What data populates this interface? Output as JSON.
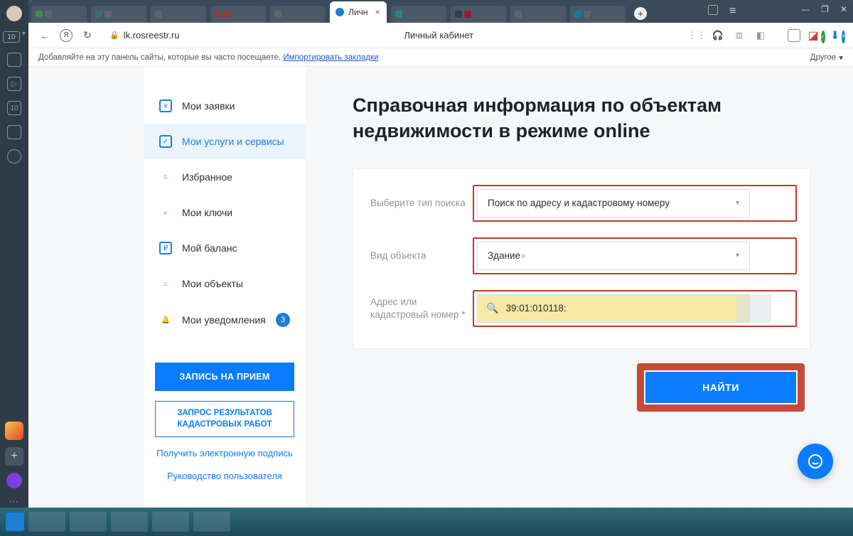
{
  "os_badge": "10",
  "active_tab": {
    "label": "Личн",
    "close": "×"
  },
  "window_controls": {
    "min": "—",
    "max": "❐",
    "close": "✕"
  },
  "address_bar": {
    "url_host": "lk.rosreestr.ru",
    "page_title_center": "Личный кабинет"
  },
  "bookmark_bar": {
    "hint": "Добавляйте на эту панель сайты, которые вы часто посещаете. ",
    "import_link": "Импортировать закладки",
    "other": "Другое"
  },
  "sidebar": {
    "items": [
      {
        "label": "Мои заявки"
      },
      {
        "label": "Мои услуги и сервисы"
      },
      {
        "label": "Избранное"
      },
      {
        "label": "Мои ключи"
      },
      {
        "label": "Мой баланс"
      },
      {
        "label": "Мои объекты"
      },
      {
        "label": "Мои уведомления",
        "badge": "3"
      }
    ],
    "actions": {
      "appointment": "ЗАПИСЬ НА ПРИЕМ",
      "request_results": "ЗАПРОС РЕЗУЛЬТАТОВ КАДАСТРОВЫХ РАБОТ",
      "get_signature": "Получить электронную подпись",
      "user_guide": "Руководство пользователя"
    }
  },
  "main": {
    "title": "Справочная информация по объектам недвижимости в режиме online",
    "rows": {
      "search_type_label": "Выберите тип поиска",
      "search_type_value": "Поиск по адресу и кадастровому номеру",
      "object_kind_label": "Вид объекта",
      "object_kind_value": "Здание",
      "address_label": "Адрес или кадастровый номер *",
      "address_value": "39:01:010118:"
    },
    "find_button": "НАЙТИ"
  }
}
